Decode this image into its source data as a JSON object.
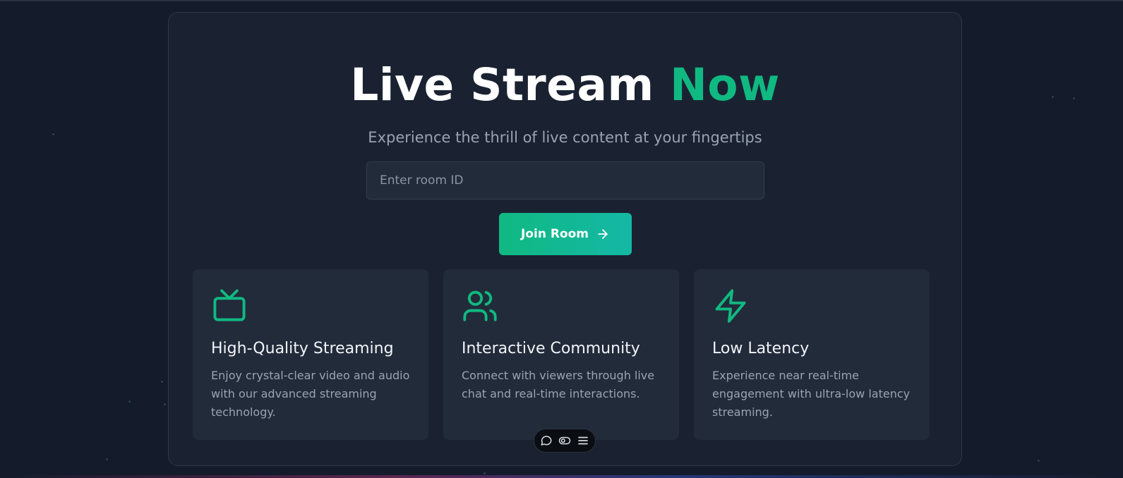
{
  "hero": {
    "title_main": "Live Stream ",
    "title_accent": "Now",
    "subtitle": "Experience the thrill of live content at your fingertips"
  },
  "room": {
    "placeholder": "Enter room ID",
    "value": "",
    "join_label": "Join Room",
    "join_icon": "arrow-right-icon"
  },
  "features": [
    {
      "icon": "tv-icon",
      "title": "High-Quality Streaming",
      "description": "Enjoy crystal-clear video and audio with our advanced streaming technology."
    },
    {
      "icon": "users-icon",
      "title": "Interactive Community",
      "description": "Connect with viewers through live chat and real-time interactions."
    },
    {
      "icon": "lightning-icon",
      "title": "Low Latency",
      "description": "Experience near real-time engagement with ultra-low latency streaming."
    }
  ],
  "toolbar": {
    "icons": [
      "chat-bubble-icon",
      "eye-icon",
      "menu-icon"
    ]
  },
  "colors": {
    "accent": "#10b981",
    "accent_end": "#14b8a6",
    "background": "#141b2b",
    "card": "#1a2232",
    "panel": "#222b3a"
  }
}
